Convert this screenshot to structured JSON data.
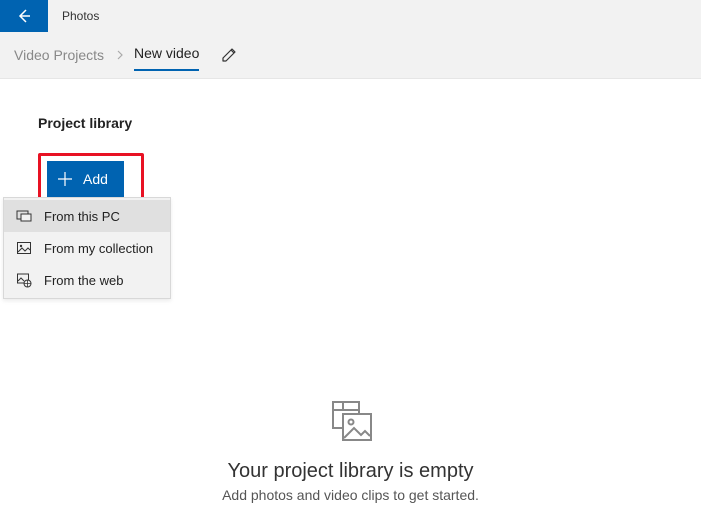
{
  "app": {
    "title": "Photos"
  },
  "breadcrumb": {
    "parent": "Video Projects",
    "current": "New video"
  },
  "library": {
    "title": "Project library",
    "add_label": "Add"
  },
  "menu": {
    "items": [
      {
        "label": "From this PC"
      },
      {
        "label": "From my collection"
      },
      {
        "label": "From the web"
      }
    ]
  },
  "empty": {
    "title": "Your project library is empty",
    "subtitle": "Add photos and video clips to get started."
  }
}
